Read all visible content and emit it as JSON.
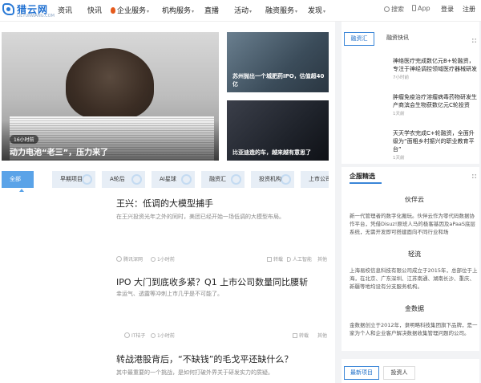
{
  "header": {
    "logo_name": "猎云网",
    "logo_domain": "LIEYUNWANG.COM",
    "nav": [
      {
        "label": "资讯",
        "caret": false,
        "hot": false
      },
      {
        "label": "快讯",
        "caret": false,
        "hot": false
      },
      {
        "label": "企业服务",
        "caret": true,
        "hot": true
      },
      {
        "label": "机构服务",
        "caret": true,
        "hot": false
      },
      {
        "label": "直播",
        "caret": false,
        "hot": false
      },
      {
        "label": "活动",
        "caret": true,
        "hot": false
      },
      {
        "label": "融资服务",
        "caret": true,
        "hot": false
      },
      {
        "label": "发现",
        "caret": true,
        "hot": false
      }
    ],
    "search_label": "搜索",
    "app_label": "App",
    "login_label": "登录",
    "register_label": "注册",
    "caret_glyph": "▾"
  },
  "hero": {
    "main_time": "16小时前",
    "main_title": "动力电池“老三”，压力来了",
    "side": [
      {
        "title": "苏州抛出一个城肥药IPO，估值超40亿"
      },
      {
        "title": "比亚迪造的车，越来越有意思了"
      }
    ]
  },
  "categories": [
    {
      "label": "全部",
      "active": true
    },
    {
      "label": "早期项目",
      "active": false
    },
    {
      "label": "A轮后",
      "active": false
    },
    {
      "label": "AI星球",
      "active": false
    },
    {
      "label": "融资汇",
      "active": false
    },
    {
      "label": "投资机构",
      "active": false
    },
    {
      "label": "上市公司",
      "active": false
    }
  ],
  "articles": [
    {
      "title": "王兴：低调的大模型捕手",
      "desc": "在王兴投资光年之外的同时，美团已经开始一场低调的大模型布局。",
      "author": "腾讯深网",
      "time": "1小时前",
      "share": "转载",
      "tag": "人工智能",
      "more": "其他"
    },
    {
      "title": "IPO 大门到底收多紧？Q1 上市公司数量同比腰斩",
      "desc": "幸运气、透露等冲刺上市几乎是不可能了。",
      "author": "IT桔子",
      "time": "1小时前",
      "share": "转载",
      "tag": "",
      "more": "其他"
    },
    {
      "title": "转战港股背后，“不缺钱”的毛戈平还缺什么？",
      "desc": "其中最重要的一个挑战，是如何打破外界关于研发实力的质疑。",
      "author": "",
      "time": "",
      "share": "",
      "tag": "",
      "more": ""
    }
  ],
  "right": {
    "tabs": [
      {
        "label": "融资汇",
        "active": true
      },
      {
        "label": "融资快讯",
        "active": false
      }
    ],
    "feed": [
      {
        "title": "神络医疗完成数亿元B+轮融资，专注于神经调控领域医疗器械研发",
        "time": "7小时前"
      },
      {
        "title": "肿瘤免疫治疗溶瘤病毒药物研发生产商滨会生物获数亿元C轮投资",
        "time": "1天前"
      },
      {
        "title": "天天学农完成C+轮融资，全面升级为“面粗乡村振兴的职业教育平台”",
        "time": "1天前"
      }
    ],
    "section_title": "企服精选",
    "enterprises": [
      {
        "name": "伙伴云",
        "desc": "新一代管理者的数字化搬玩。伙伴云作为零代码数据协作平台，凭借Disuz!原班人马的极客基因及aPaaS底层系统，无需开发即可搭建面向不同行业和场"
      },
      {
        "name": "轻流",
        "desc": "上海易校信息科技有限公司成立于2015年，总部位于上海，在北京、广东深圳、江苏南通、湖南长沙、重庆、新疆等地均设有分支服务机构。"
      },
      {
        "name": "金数据",
        "desc": "金数据创立于2012年，隶明略科技集团旗下品牌，是一家为个人和企业客户解决数据收集管理问题的公司。"
      }
    ],
    "bottom_tabs": [
      {
        "label": "最新项目",
        "active": true
      },
      {
        "label": "投资人",
        "active": false
      }
    ]
  },
  "colors": {
    "accent": "#3a86d8",
    "cat_active": "#5aa3e8",
    "cat_bg": "#e7eef6",
    "hot": "#e55a1c"
  }
}
